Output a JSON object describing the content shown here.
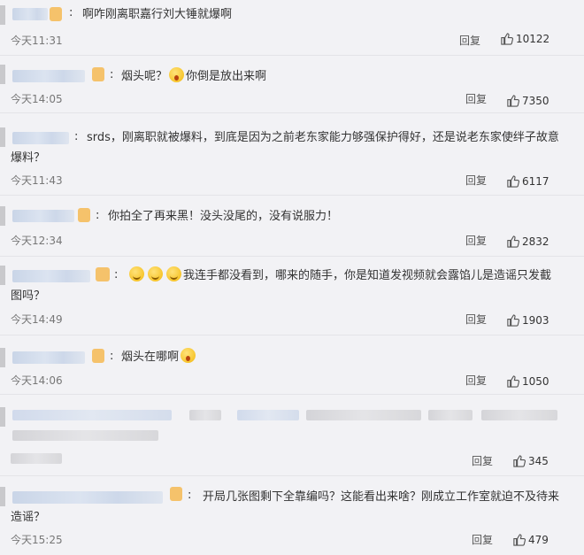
{
  "comments": [
    {
      "text": "啊咋刚离职嘉行刘大锤就爆啊",
      "time": "今天11:31",
      "reply": "回复",
      "likes": "10122"
    },
    {
      "text_a": "烟头呢？",
      "text_b": "你倒是放出来啊",
      "time": "今天14:05",
      "reply": "回复",
      "likes": "7350"
    },
    {
      "line1": "srds，刚离职就被爆料，到底是因为之前老东家能力够强保护得好，还是说老东家使绊子故意",
      "line2": "爆料？",
      "time": "今天11:43",
      "reply": "回复",
      "likes": "6117"
    },
    {
      "text": "你拍全了再来黑！没头没尾的，没有说服力！",
      "time": "今天12:34",
      "reply": "回复",
      "likes": "2832"
    },
    {
      "line1": "我连手都没看到，哪来的随手，你是知道发视频就会露馅儿是造谣只发截",
      "line2": "图吗？",
      "time": "今天14:49",
      "reply": "回复",
      "likes": "1903"
    },
    {
      "text": "烟头在哪啊",
      "time": "今天14:06",
      "reply": "回复",
      "likes": "1050"
    },
    {
      "reply": "回复",
      "likes": "345"
    },
    {
      "line1": "开局几张图剩下全靠编吗？这能看出来啥？刚成立工作室就迫不及待来",
      "line2": "造谣？",
      "time": "今天15:25",
      "reply": "回复",
      "likes": "479"
    }
  ],
  "icons": {
    "like": "thumbs-up-icon",
    "emoji": "face-emoji-icon"
  }
}
